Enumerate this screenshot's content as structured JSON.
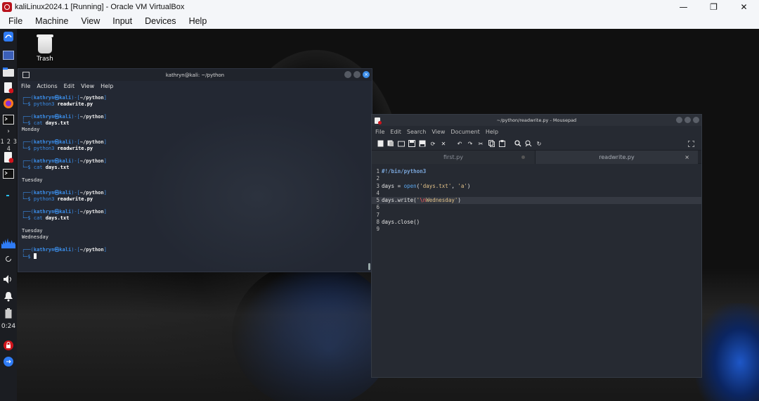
{
  "vbox": {
    "title": "kaliLinux2024.1 [Running] - Oracle VM VirtualBox",
    "minimize": "—",
    "restore": "❐",
    "close": "✕",
    "menu": [
      "File",
      "Machine",
      "View",
      "Input",
      "Devices",
      "Help"
    ]
  },
  "desktop": {
    "trash_label": "Trash"
  },
  "dock": {
    "workspaces": "1 2 3 4",
    "time": "0:24"
  },
  "terminal": {
    "title": "kathryn@kali: ~/python",
    "menu": [
      "File",
      "Actions",
      "Edit",
      "View",
      "Help"
    ],
    "user": "kathryn",
    "host": "kali",
    "path": "~/python",
    "blocks": [
      {
        "cmd": "python3",
        "arg": "readwrite.py",
        "output": []
      },
      {
        "cmd": "cat",
        "arg": "days.txt",
        "output": [
          "Monday"
        ]
      },
      {
        "cmd": "python3",
        "arg": "readwrite.py",
        "output": []
      },
      {
        "cmd": "cat",
        "arg": "days.txt",
        "output": [
          "",
          "Tuesday"
        ]
      },
      {
        "cmd": "python3",
        "arg": "readwrite.py",
        "output": []
      },
      {
        "cmd": "cat",
        "arg": "days.txt",
        "output": [
          "",
          "Tuesday",
          "Wednesday"
        ]
      }
    ]
  },
  "mousepad": {
    "title": "~/python/readwrite.py - Mousepad",
    "menu": [
      "File",
      "Edit",
      "Search",
      "View",
      "Document",
      "Help"
    ],
    "tabs": [
      {
        "label": "first.py",
        "active": false
      },
      {
        "label": "readwrite.py",
        "active": true
      }
    ],
    "tab_close": "×",
    "code": {
      "line1": "#!/bin/python3",
      "line3_a": "days = ",
      "line3_fn": "open",
      "line3_b": "(",
      "line3_s1": "'days.txt'",
      "line3_c": ", ",
      "line3_s2": "'a'",
      "line3_d": ")",
      "line5_a": "days.write(",
      "line5_q": "'",
      "line5_esc": "\\n",
      "line5_s": "Wednesday'",
      "line5_d": ")",
      "line8": "days.close()"
    },
    "line_numbers": [
      "1",
      "2",
      "3",
      "4",
      "5",
      "6",
      "7",
      "8",
      "9"
    ]
  },
  "colors": {
    "prompt_blue": "#3b8eea",
    "string": "#e0c088",
    "escape": "#ff5f5f"
  }
}
